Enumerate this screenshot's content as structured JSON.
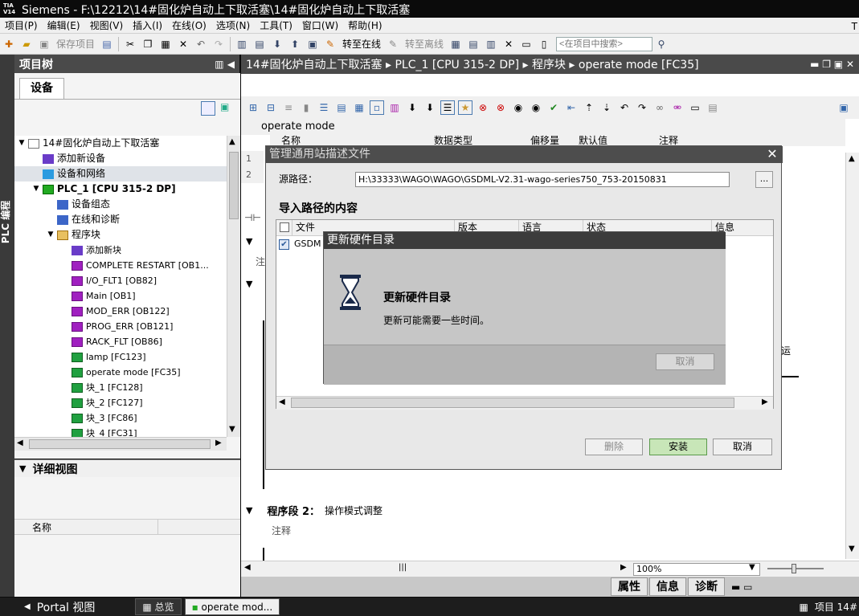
{
  "title": {
    "logo": "TIA\nV14",
    "text": "Siemens  -  F:\\12212\\14#固化炉自动上下取活塞\\14#固化炉自动上下取活塞"
  },
  "menu": [
    "项目(P)",
    "编辑(E)",
    "视图(V)",
    "插入(I)",
    "在线(O)",
    "选项(N)",
    "工具(T)",
    "窗口(W)",
    "帮助(H)"
  ],
  "menu_right": "T",
  "toolbar": {
    "save_project": "保存项目",
    "go_online": "转至在线",
    "go_offline": "转至离线",
    "search_placeholder": "<在项目中搜索>"
  },
  "side_tab": "PLC 编程",
  "tree": {
    "header": "项目树",
    "tab": "设备",
    "items": [
      {
        "label": "14#固化炉自动上下取活塞",
        "indent": 0,
        "exp": "▼",
        "icon": "doc"
      },
      {
        "label": "添加新设备",
        "indent": 1,
        "exp": "",
        "icon": "star"
      },
      {
        "label": "设备和网络",
        "indent": 1,
        "exp": "",
        "icon": "net",
        "selected": true
      },
      {
        "label": "PLC_1 [CPU 315-2 DP]",
        "indent": 1,
        "exp": "▼",
        "icon": "plc",
        "bold": true
      },
      {
        "label": "设备组态",
        "indent": 2,
        "exp": "",
        "icon": "dev"
      },
      {
        "label": "在线和诊断",
        "indent": 2,
        "exp": "",
        "icon": "dev"
      },
      {
        "label": "程序块",
        "indent": 2,
        "exp": "▼",
        "icon": "fold"
      },
      {
        "label": "添加新块",
        "indent": 3,
        "exp": "",
        "icon": "star"
      },
      {
        "label": "COMPLETE RESTART [OB1...",
        "indent": 3,
        "exp": "",
        "icon": "blk-p"
      },
      {
        "label": "I/O_FLT1 [OB82]",
        "indent": 3,
        "exp": "",
        "icon": "blk-p"
      },
      {
        "label": "Main [OB1]",
        "indent": 3,
        "exp": "",
        "icon": "blk-p"
      },
      {
        "label": "MOD_ERR [OB122]",
        "indent": 3,
        "exp": "",
        "icon": "blk-p"
      },
      {
        "label": "PROG_ERR [OB121]",
        "indent": 3,
        "exp": "",
        "icon": "blk-p"
      },
      {
        "label": "RACK_FLT [OB86]",
        "indent": 3,
        "exp": "",
        "icon": "blk-p"
      },
      {
        "label": "lamp [FC123]",
        "indent": 3,
        "exp": "",
        "icon": "blk-g"
      },
      {
        "label": "operate mode [FC35]",
        "indent": 3,
        "exp": "",
        "icon": "blk-g"
      },
      {
        "label": "块_1 [FC128]",
        "indent": 3,
        "exp": "",
        "icon": "blk-g"
      },
      {
        "label": "块_2 [FC127]",
        "indent": 3,
        "exp": "",
        "icon": "blk-g"
      },
      {
        "label": "块_3 [FC86]",
        "indent": 3,
        "exp": "",
        "icon": "blk-g"
      },
      {
        "label": "块_4 [FC31]",
        "indent": 3,
        "exp": "",
        "icon": "blk-g"
      }
    ]
  },
  "detail": {
    "header": "详细视图",
    "col_name": "名称"
  },
  "editor": {
    "breadcrumb": "14#固化炉自动上下取活塞  ▸  PLC_1 [CPU 315-2 DP]  ▸  程序块  ▸  operate mode [FC35]",
    "block_title": "operate mode",
    "iface_cols": [
      "名称",
      "数据类型",
      "偏移量",
      "默认值",
      "注释"
    ],
    "rows": [
      "1",
      "2"
    ],
    "network2_label": "程序段 2：",
    "network2_title": "操作模式调整",
    "comment": "注释",
    "zoom": "100%",
    "frag_run": "运",
    "frag_zhu": "注"
  },
  "prop_tabs": [
    "属性",
    "信息",
    "诊断"
  ],
  "taskbar": {
    "portal": "Portal 视图",
    "overview": "总览",
    "active": "operate mod...",
    "right": "项目 14#"
  },
  "dialog_gsd": {
    "title": "管理通用站描述文件",
    "source_label": "源路径：",
    "source_value": "H:\\33333\\WAGO\\WAGO\\GSDML-V2.31-wago-series750_753-20150831",
    "browse": "...",
    "content_label": "导入路径的内容",
    "cols": [
      "文件",
      "版本",
      "语言",
      "状态",
      "信息"
    ],
    "row_file": "GSDM",
    "btn_delete": "删除",
    "btn_install": "安装",
    "btn_cancel": "取消"
  },
  "dialog_update": {
    "title": "更新硬件目录",
    "heading": "更新硬件目录",
    "message": "更新可能需要一些时间。",
    "btn_cancel": "取消"
  }
}
